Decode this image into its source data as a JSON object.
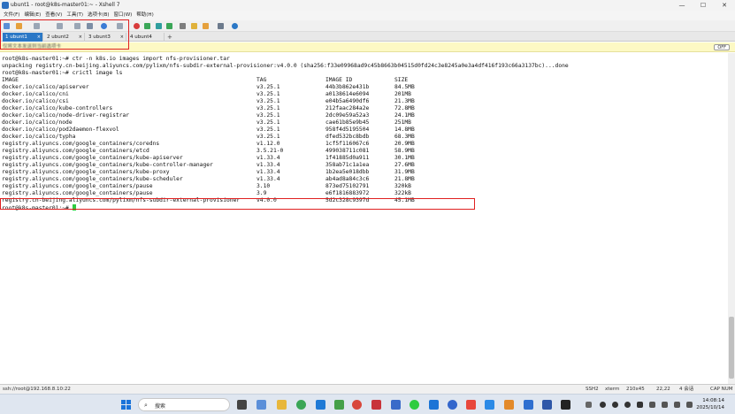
{
  "window": {
    "title": "ubunt1 - root@k8s-master01:~ - Xshell 7",
    "controls": [
      "—",
      "☐",
      "✕"
    ]
  },
  "menu": [
    "文件(F)",
    "编辑(E)",
    "查看(V)",
    "工具(T)",
    "选项卡(B)",
    "窗口(W)",
    "帮助(H)"
  ],
  "tabs": [
    {
      "label": "1 ubunt1",
      "close": "×"
    },
    {
      "label": "2 ubunt2",
      "close": "×"
    },
    {
      "label": "3 ubunt3",
      "close": "×"
    },
    {
      "label": "4 ubunt4",
      "close": ""
    }
  ],
  "tab_add": "+",
  "notice": {
    "text": "仅将文本发送到当前选项卡",
    "button": "OFF"
  },
  "terminal": {
    "lines": [
      "root@k8s-master01:~# ctr -n k8s.io images import nfs-provisioner.tar",
      "unpacking registry.cn-beijing.aliyuncs.com/pylixm/nfs-subdir-external-provisioner:v4.0.0 (sha256:f33e09968ad9c45b8663b04515d0fd24c3e8245a0e3a4df416f193c66a3137bc)...done",
      "root@k8s-master01:~# crictl image ls"
    ],
    "headers": [
      "IMAGE",
      "TAG",
      "IMAGE ID",
      "SIZE"
    ],
    "rows": [
      [
        "docker.io/calico/apiserver",
        "v3.25.1",
        "44b3b862e431b",
        "84.5MB"
      ],
      [
        "docker.io/calico/cni",
        "v3.25.1",
        "a0138614e6094",
        "201MB"
      ],
      [
        "docker.io/calico/csi",
        "v3.25.1",
        "e04b5a6490df6",
        "21.3MB"
      ],
      [
        "docker.io/calico/kube-controllers",
        "v3.25.1",
        "212faac284a2e",
        "72.8MB"
      ],
      [
        "docker.io/calico/node-driver-registrar",
        "v3.25.1",
        "2dc09e59a52a3",
        "24.1MB"
      ],
      [
        "docker.io/calico/node",
        "v3.25.1",
        "cae61b85e9b45",
        "251MB"
      ],
      [
        "docker.io/calico/pod2daemon-flexvol",
        "v3.25.1",
        "958f4d5195504",
        "14.8MB"
      ],
      [
        "docker.io/calico/typha",
        "v3.25.1",
        "dfed532bc8bdb",
        "68.3MB"
      ],
      [
        "registry.aliyuncs.com/google_containers/coredns",
        "v1.12.0",
        "1cf5f116067c6",
        "20.9MB"
      ],
      [
        "registry.aliyuncs.com/google_containers/etcd",
        "3.5.21-0",
        "499038711c081",
        "58.9MB"
      ],
      [
        "registry.aliyuncs.com/google_containers/kube-apiserver",
        "v1.33.4",
        "1f41885d0a911",
        "30.1MB"
      ],
      [
        "registry.aliyuncs.com/google_containers/kube-controller-manager",
        "v1.33.4",
        "358ab71c1a1ea",
        "27.6MB"
      ],
      [
        "registry.aliyuncs.com/google_containers/kube-proxy",
        "v1.33.4",
        "1b2ea5e018dbb",
        "31.9MB"
      ],
      [
        "registry.aliyuncs.com/google_containers/kube-scheduler",
        "v1.33.4",
        "ab4ad8a84c3c6",
        "21.8MB"
      ],
      [
        "registry.aliyuncs.com/google_containers/pause",
        "3.10",
        "873ed75102791",
        "320kB"
      ],
      [
        "registry.aliyuncs.com/google_containers/pause",
        "3.9",
        "e6f1816883972",
        "322kB"
      ],
      [
        "registry.cn-beijing.aliyuncs.com/pylixm/nfs-subdir-external-provisioner",
        "v4.0.0",
        "5d2c328c9397d",
        "45.1MB"
      ]
    ],
    "prompt": "root@k8s-master01:~# "
  },
  "statusbar": {
    "session": "ssh://root@192.168.8.10:22",
    "protocol": "SSH2",
    "term": "xterm",
    "size": "210x45",
    "pos": "22,22",
    "sessions": "4 会话",
    "caps": "CAP NUM"
  },
  "taskbar": {
    "search_label": "搜索",
    "time": "14:08:14",
    "date": "2025/10/14"
  },
  "colors": {
    "accent": "#2b78c6",
    "highlight": "#e02020",
    "cursor": "#2ecc40",
    "notice_bg": "#fdf9c4"
  }
}
